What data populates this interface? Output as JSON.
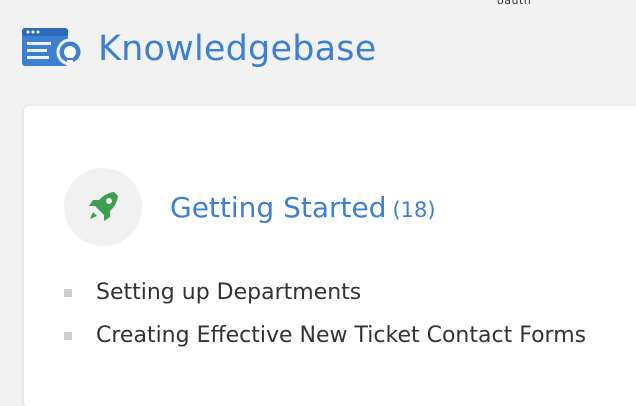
{
  "top_fragment": "oauth",
  "header": {
    "title": "Knowledgebase",
    "icon": "knowledgebase-lightbulb-icon"
  },
  "category": {
    "name": "Getting Started",
    "count": "(18)",
    "icon": "rocket-icon",
    "articles": [
      {
        "title": "Setting up Departments"
      },
      {
        "title": "Creating Effective New Ticket Contact Forms"
      }
    ]
  },
  "colors": {
    "link": "#3d7fd0",
    "rocket": "#3f9e4f",
    "page_bg": "#f2f2f2"
  }
}
